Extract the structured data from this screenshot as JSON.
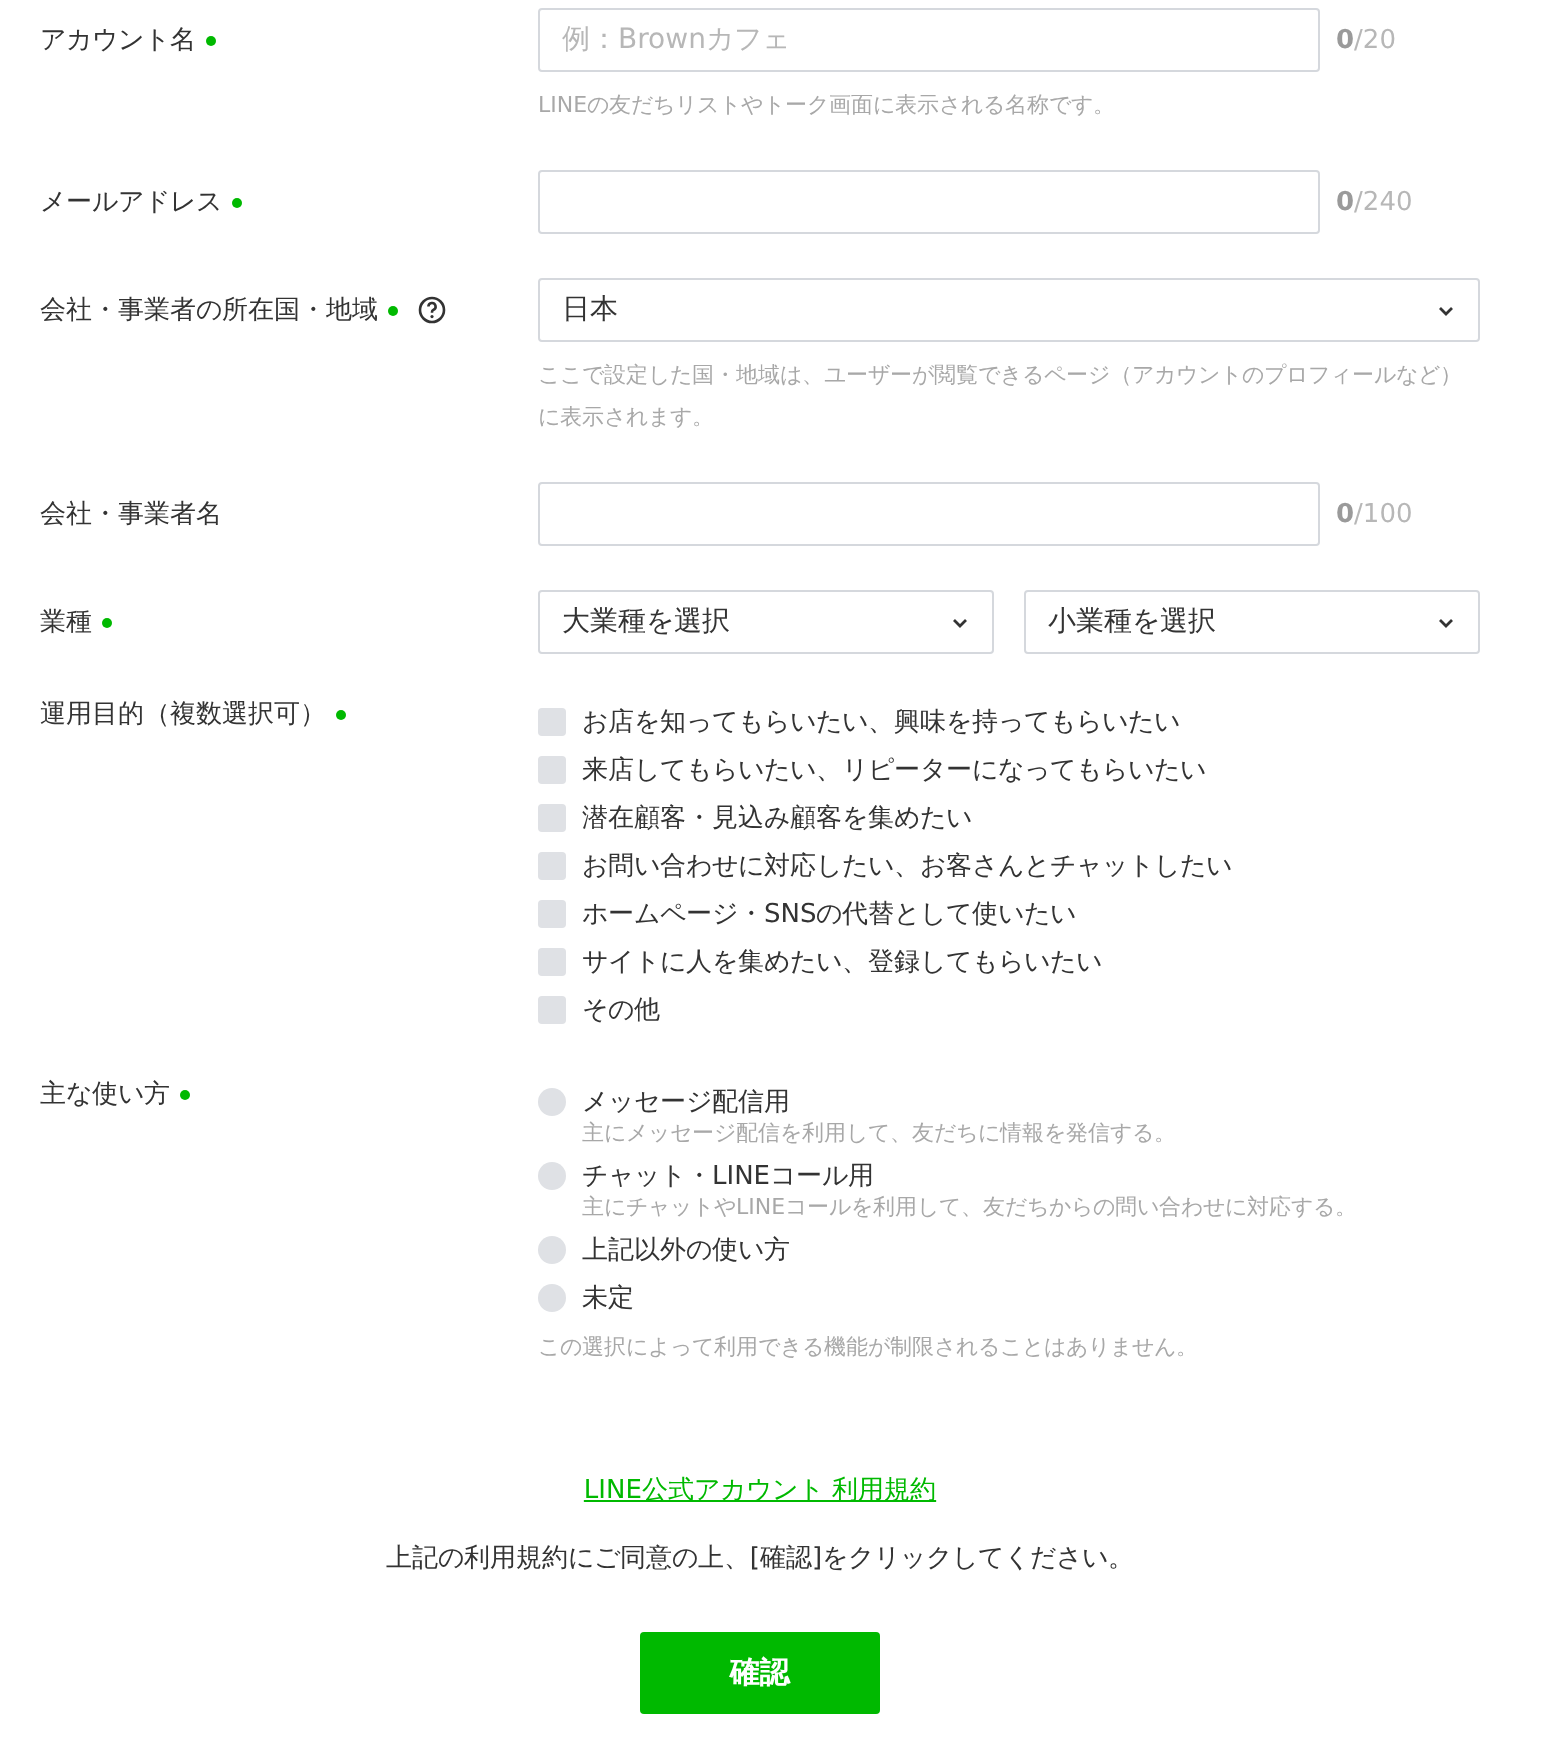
{
  "fields": [
    {
      "kind": "text",
      "label": "アカウント名",
      "required": true,
      "placeholder": "例：Brownカフェ",
      "counter": "**0**/20",
      "hint": "LINEの友だちリストやトーク画面に表示される名称です。"
    },
    {
      "kind": "text",
      "label": "メールアドレス",
      "required": true,
      "counter": "**0**/240"
    },
    {
      "kind": "select",
      "label": "会社・事業者の所在国・地域",
      "required": true,
      "help": true,
      "value": "日本",
      "hint": "ここで設定した国・地域は、ユーザーが閲覧できるページ（アカウントのプロフィールなど）に表示されます。"
    },
    {
      "kind": "text",
      "label": "会社・事業者名",
      "counter": "**0**/100"
    },
    {
      "kind": "select-pair",
      "label": "業種",
      "required": true,
      "values": [
        "大業種を選択",
        "小業種を選択"
      ]
    },
    {
      "kind": "checkboxes",
      "label": "運用目的（複数選択可）",
      "required": true,
      "options": [
        {
          "label": "お店を知ってもらいたい、興味を持ってもらいたい",
          "checked": false
        },
        {
          "label": "来店してもらいたい、リピーターになってもらいたい",
          "checked": false
        },
        {
          "label": "潜在顧客・見込み顧客を集めたい",
          "checked": false
        },
        {
          "label": "お問い合わせに対応したい、お客さんとチャットしたい",
          "checked": false
        },
        {
          "label": "ホームページ・SNSの代替として使いたい",
          "checked": false
        },
        {
          "label": "サイトに人を集めたい、登録してもらいたい",
          "checked": false
        },
        {
          "label": "その他",
          "checked": false
        }
      ]
    },
    {
      "kind": "radios",
      "label": "主な使い方",
      "required": true,
      "options": [
        {
          "label": "メッセージ配信用",
          "selected": false,
          "note": "主にメッセージ配信を利用して、友だちに情報を発信する。"
        },
        {
          "label": "チャット・LINEコール用",
          "selected": false,
          "note": "主にチャットやLINEコールを利用して、友だちからの問い合わせに対応する。"
        },
        {
          "label": "上記以外の使い方",
          "selected": false
        },
        {
          "label": "未定",
          "selected": false
        }
      ],
      "hint": "この選択によって利用できる機能が制限されることはありません。"
    }
  ],
  "terms_link": "LINE公式アカウント 利用規約",
  "terms_note": "上記の利用規約にご同意の上、[確認]をクリックしてください。",
  "confirm_button": "確認"
}
